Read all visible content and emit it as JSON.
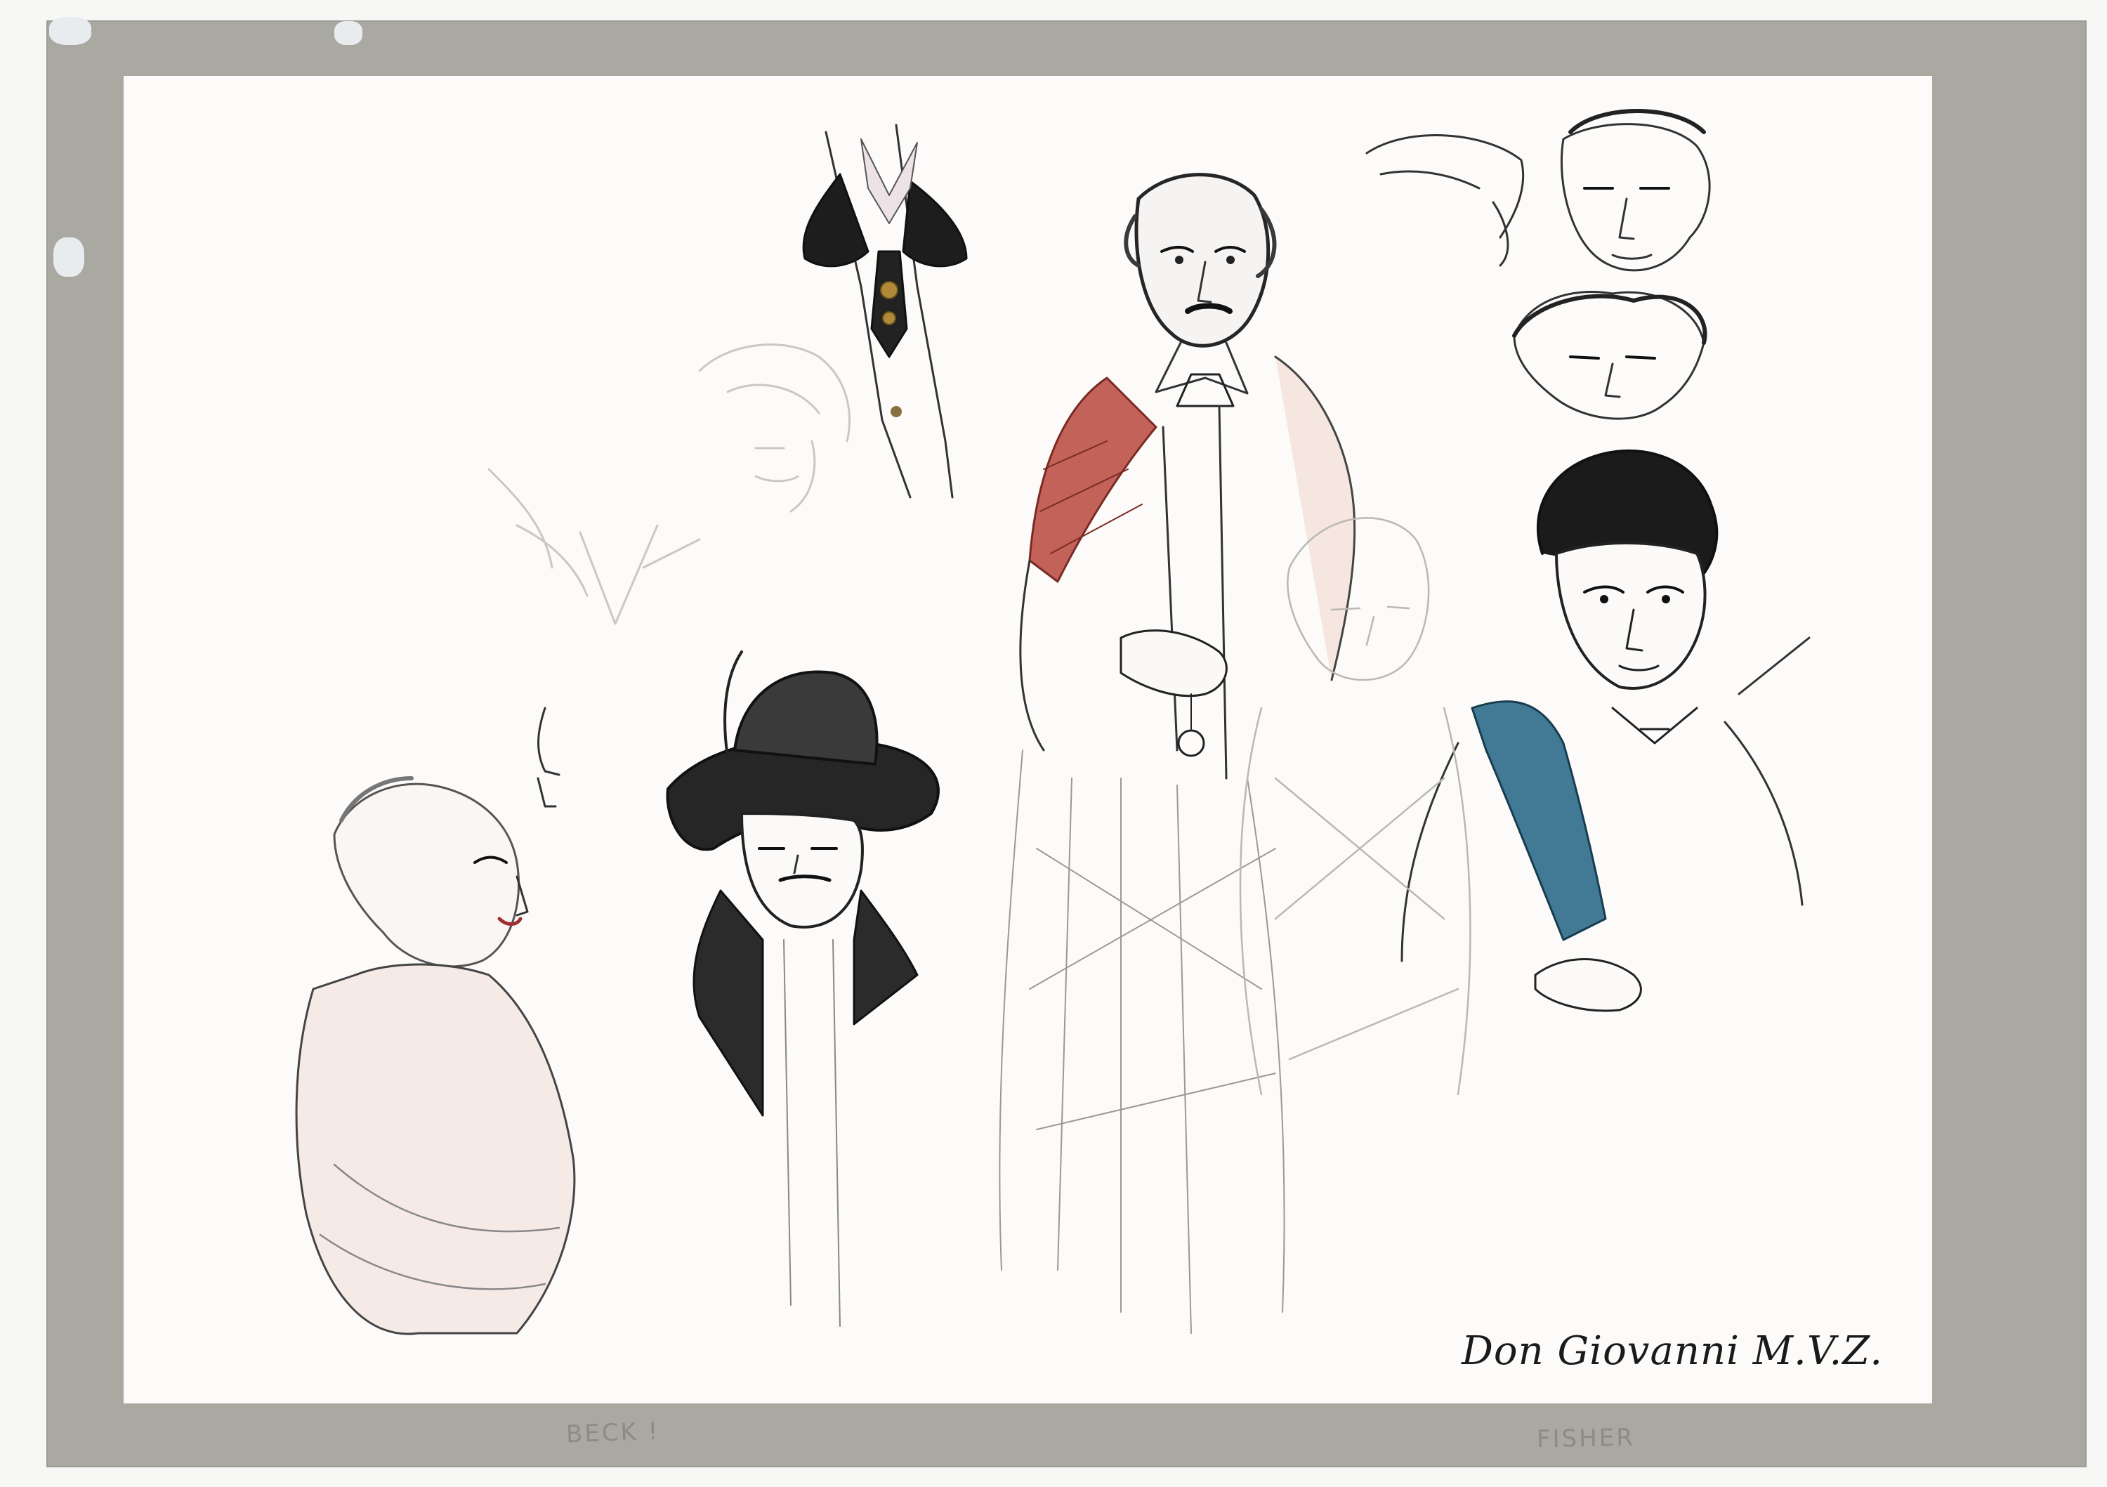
{
  "artwork": {
    "signature": "Don Giovanni M.V.Z.",
    "margin_notes": [
      "BECK !",
      "FISHER"
    ],
    "colors": {
      "mat": "#a9a8a1",
      "paper": "#fcfbf9",
      "ink": "#1a1a1a",
      "pencil": "#9a9994",
      "red_wash": "#b0443c",
      "blue_wash": "#2d6a88",
      "skin_wash": "#e7c3b8"
    }
  }
}
